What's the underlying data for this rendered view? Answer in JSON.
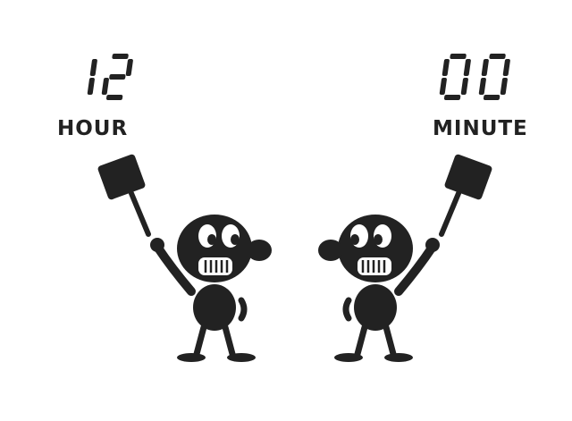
{
  "clock": {
    "hour_value": "12",
    "hour_label": "HOUR",
    "minute_value": "00",
    "minute_label": "MINUTE"
  },
  "characters": [
    {
      "name": "left-hammer-character",
      "holds": "hammer-icon"
    },
    {
      "name": "right-hammer-character",
      "holds": "hammer-icon"
    }
  ],
  "colors": {
    "ink": "#222222",
    "background": "#ffffff"
  }
}
